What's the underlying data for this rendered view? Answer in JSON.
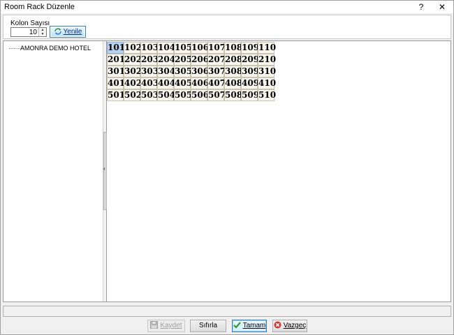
{
  "window": {
    "title": "Room Rack Düzenle",
    "help_label": "?",
    "close_label": "✕"
  },
  "top": {
    "kolon_label": "Kolon Sayısı",
    "kolon_value": "10",
    "refresh_label": "Yenile"
  },
  "tree": {
    "items": [
      "AMONRA DEMO HOTEL"
    ]
  },
  "rack": {
    "columns": 10,
    "rows": [
      [
        "101",
        "102",
        "103",
        "104",
        "105",
        "106",
        "107",
        "108",
        "109",
        "110"
      ],
      [
        "201",
        "202",
        "203",
        "204",
        "205",
        "206",
        "207",
        "208",
        "209",
        "210"
      ],
      [
        "301",
        "302",
        "303",
        "304",
        "305",
        "306",
        "307",
        "308",
        "309",
        "310"
      ],
      [
        "401",
        "402",
        "403",
        "404",
        "405",
        "406",
        "407",
        "408",
        "409",
        "410"
      ],
      [
        "501",
        "502",
        "503",
        "504",
        "505",
        "506",
        "507",
        "508",
        "509",
        "510"
      ]
    ],
    "selected": "101"
  },
  "buttons": {
    "save_label": "Kaydet",
    "reset_label": "Sıfırla",
    "ok_label": "Tamam",
    "cancel_label": "Vazgeç"
  },
  "colors": {
    "selected_room": "#b8d3ef",
    "room_bg": "#f8f6ee"
  },
  "icons": {
    "refresh": "refresh-icon",
    "save": "save-icon",
    "ok": "check-icon",
    "cancel": "cancel-icon"
  }
}
